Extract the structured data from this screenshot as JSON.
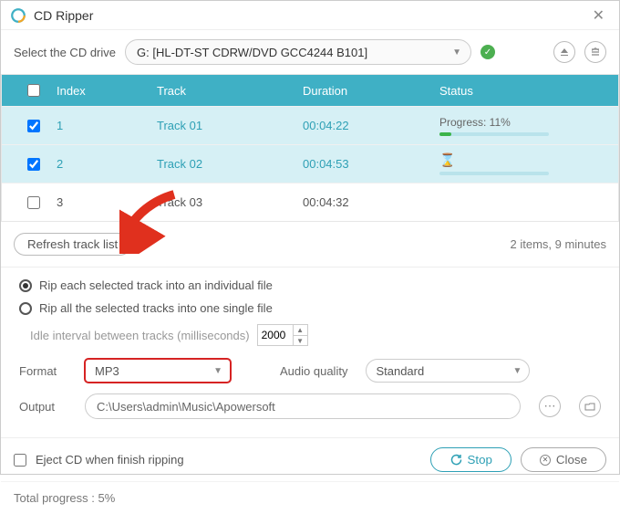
{
  "window": {
    "title": "CD Ripper"
  },
  "drive": {
    "label": "Select the CD drive",
    "value": "G: [HL-DT-ST CDRW/DVD GCC4244 B101]"
  },
  "table": {
    "headers": {
      "index": "Index",
      "track": "Track",
      "duration": "Duration",
      "status": "Status"
    },
    "rows": [
      {
        "checked": true,
        "index": "1",
        "track": "Track 01",
        "duration": "00:04:22",
        "status_type": "progress",
        "progress_label": "Progress: 11%",
        "progress_pct": 11
      },
      {
        "checked": true,
        "index": "2",
        "track": "Track 02",
        "duration": "00:04:53",
        "status_type": "waiting"
      },
      {
        "checked": false,
        "index": "3",
        "track": "Track 03",
        "duration": "00:04:32",
        "status_type": "none"
      }
    ]
  },
  "toolbar": {
    "refresh_label": "Refresh track list",
    "summary": "2 items, 9 minutes"
  },
  "rip_mode": {
    "individual": "Rip each selected track into an individual file",
    "single": "Rip all the selected tracks into one single file",
    "selected": "individual",
    "idle_label": "Idle interval between tracks (milliseconds)",
    "idle_value": "2000"
  },
  "format": {
    "label": "Format",
    "value": "MP3"
  },
  "quality": {
    "label": "Audio quality",
    "value": "Standard"
  },
  "output": {
    "label": "Output",
    "path": "C:\\Users\\admin\\Music\\Apowersoft"
  },
  "footer": {
    "eject_label": "Eject CD when finish ripping",
    "eject_checked": false,
    "stop_label": "Stop",
    "close_label": "Close",
    "total_label": "Total progress : 5%"
  }
}
